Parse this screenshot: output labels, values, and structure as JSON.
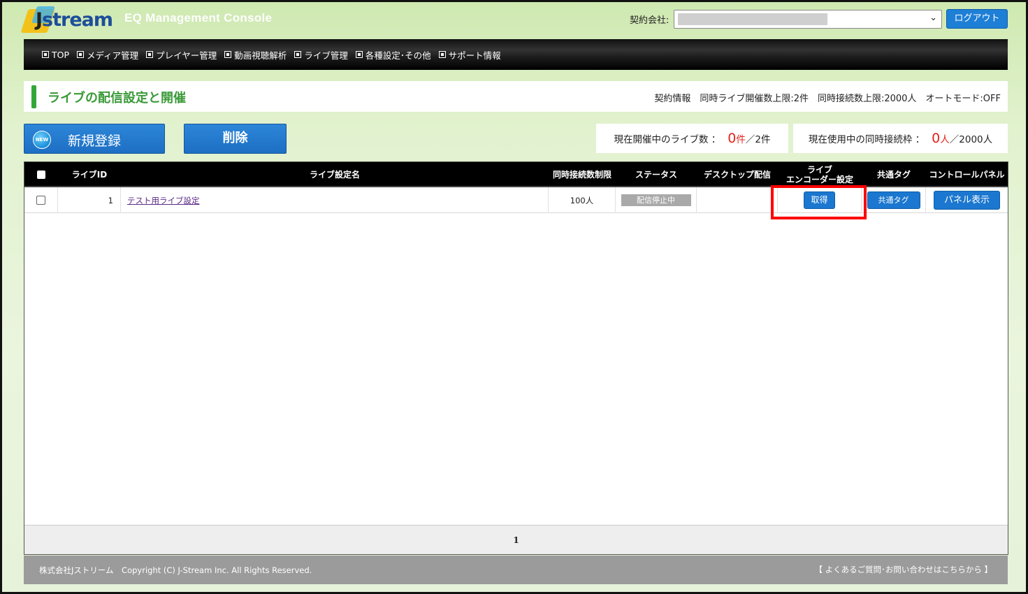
{
  "header": {
    "logo_text": "stream",
    "logo_initial": "J",
    "console_title": "EQ Management Console",
    "contract_label": "契約会社:",
    "logout_label": "ログアウト"
  },
  "nav": {
    "items": [
      "TOP",
      "メディア管理",
      "プレイヤー管理",
      "動画視聴解析",
      "ライブ管理",
      "各種設定･その他",
      "サポート情報"
    ]
  },
  "page": {
    "title": "ライブの配信設定と開催",
    "contract_info": "契約情報　同時ライブ開催数上限:2件　同時接続数上限:2000人　オートモード:OFF"
  },
  "actions": {
    "new_badge": "NEW",
    "new_label": "新規登録",
    "delete_label": "削除"
  },
  "stats": {
    "live_label": "現在開催中のライブ数 ：",
    "live_count": "0",
    "live_unit": "件",
    "live_limit": "／2件",
    "conn_label": "現在使用中の同時接続枠 ：",
    "conn_count": "0",
    "conn_unit": "人",
    "conn_limit": "／2000人"
  },
  "table": {
    "headers": {
      "live_id": "ライブID",
      "name": "ライブ設定名",
      "conn_limit": "同時接続数制限",
      "status": "ステータス",
      "desktop": "デスクトップ配信",
      "encoder_line1": "ライブ",
      "encoder_line2": "エンコーダー設定",
      "tag": "共通タグ",
      "panel": "コントロールパネル"
    },
    "rows": [
      {
        "id": "1",
        "name": "テスト用ライブ設定",
        "conn_limit": "100人",
        "status": "配信停止中",
        "desktop": "",
        "encoder_button": "取得",
        "tag_button": "共通タグ",
        "panel_button": "パネル表示"
      }
    ],
    "pager": "1"
  },
  "footer": {
    "copyright": "株式会社Jストリーム　Copyright (C) J-Stream Inc. All Rights Reserved.",
    "faq": "【 よくあるご質問･お問い合わせはこちらから 】"
  },
  "colors": {
    "accent_green": "#3a9a38",
    "button_blue": "#1d6fc4",
    "alert_red": "#e3231c",
    "highlight_red": "#ff0000"
  }
}
